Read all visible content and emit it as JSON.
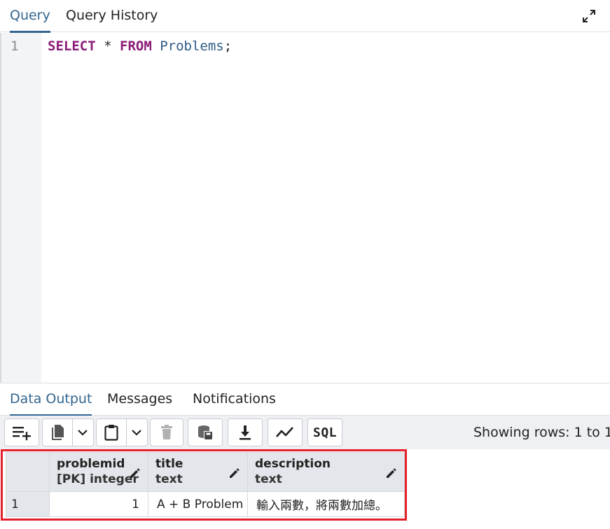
{
  "top_tabs": [
    {
      "label": "Query",
      "active": true
    },
    {
      "label": "Query History",
      "active": false
    }
  ],
  "editor": {
    "line_number": "1",
    "code": {
      "keyword_select": "SELECT",
      "star": "*",
      "keyword_from": "FROM",
      "table": "Problems",
      "terminator": ";"
    }
  },
  "output_tabs": [
    {
      "label": "Data Output",
      "active": true
    },
    {
      "label": "Messages",
      "active": false
    },
    {
      "label": "Notifications",
      "active": false
    }
  ],
  "toolbar": {
    "sql_label": "SQL",
    "rows_info": "Showing rows: 1 to 1"
  },
  "grid": {
    "columns": [
      {
        "name": "problemid",
        "type": "[PK] integer"
      },
      {
        "name": "title",
        "type": "text"
      },
      {
        "name": "description",
        "type": "text"
      }
    ],
    "rows": [
      {
        "row_number": "1",
        "problemid": "1",
        "title": "A + B Problem",
        "description": "輸入兩數，將兩數加總。"
      }
    ]
  },
  "colors": {
    "accent": "#326690",
    "keyword": "#8b1a78",
    "identifier": "#2d5a86",
    "highlight": "#e3202b"
  }
}
